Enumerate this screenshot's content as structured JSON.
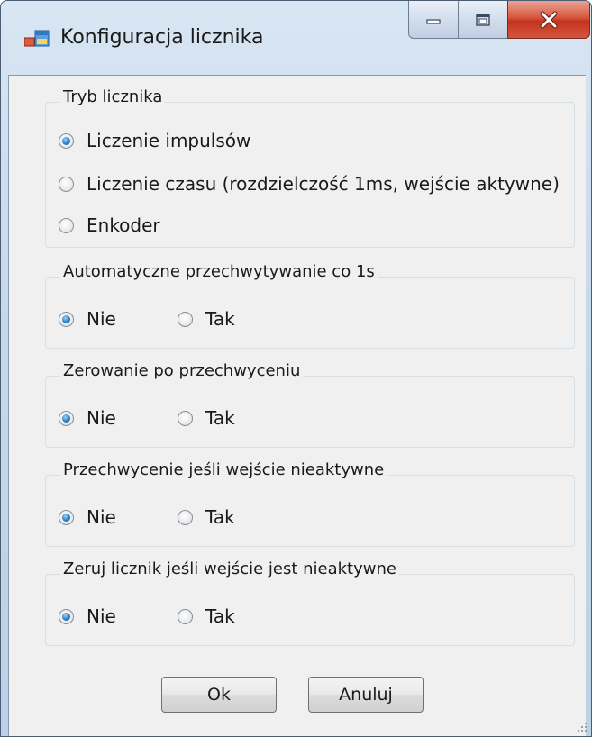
{
  "window": {
    "title": "Konfiguracja licznika"
  },
  "groups": [
    {
      "title": "Tryb licznika",
      "options": [
        {
          "label": "Liczenie impulsów",
          "checked": true
        },
        {
          "label": "Liczenie czasu (rozdzielczość 1ms, wejście aktywne)",
          "checked": false
        },
        {
          "label": "Enkoder",
          "checked": false
        }
      ]
    },
    {
      "title": "Automatyczne przechwytywanie co 1s",
      "options": [
        {
          "label": "Nie",
          "checked": true
        },
        {
          "label": "Tak",
          "checked": false
        }
      ]
    },
    {
      "title": "Zerowanie po przechwyceniu",
      "options": [
        {
          "label": "Nie",
          "checked": true
        },
        {
          "label": "Tak",
          "checked": false
        }
      ]
    },
    {
      "title": "Przechwycenie jeśli wejście nieaktywne",
      "options": [
        {
          "label": "Nie",
          "checked": true
        },
        {
          "label": "Tak",
          "checked": false
        }
      ]
    },
    {
      "title": "Zeruj licznik jeśli wejście jest nieaktywne",
      "options": [
        {
          "label": "Nie",
          "checked": true
        },
        {
          "label": "Tak",
          "checked": false
        }
      ]
    }
  ],
  "buttons": {
    "ok_label": "Ok",
    "cancel_label": "Anuluj"
  },
  "colors": {
    "titlebar": "#c7d9ec",
    "close_button": "#c2341c",
    "client_background": "#f0f0f0",
    "radio_checked": "#2a7dc6"
  }
}
